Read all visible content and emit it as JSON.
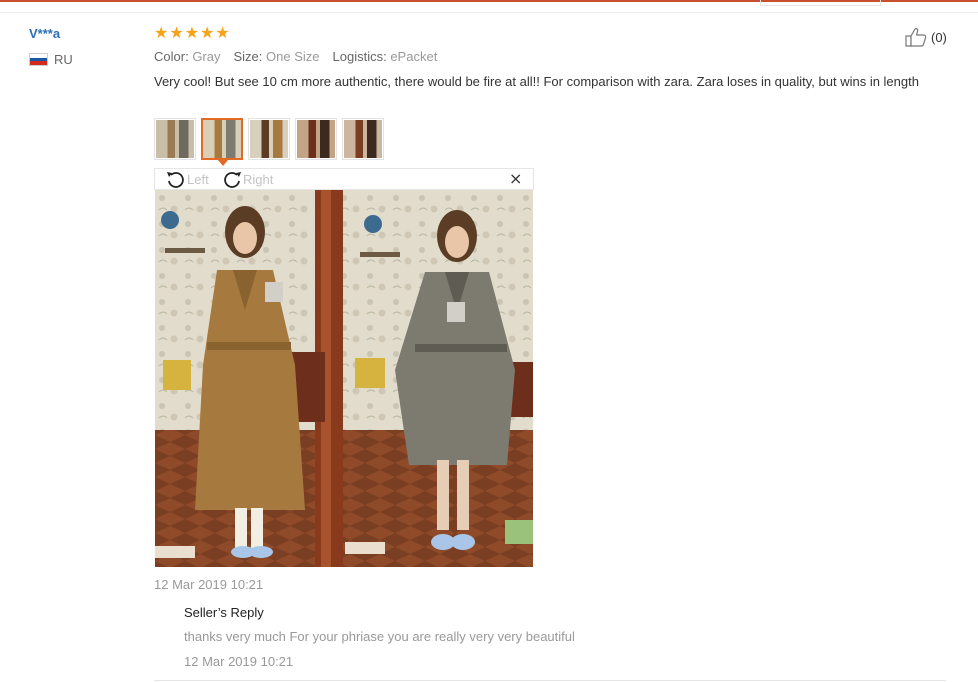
{
  "review": {
    "buyer": {
      "name": "V***a",
      "country": "RU",
      "flag_colors": [
        "#ffffff",
        "#1c57a5",
        "#d52b1e"
      ]
    },
    "rating": 5,
    "star_glyph": "★",
    "attributes": {
      "color_label": "Color:",
      "color_value": "Gray",
      "size_label": "Size:",
      "size_value": "One Size",
      "logistics_label": "Logistics:",
      "logistics_value": "ePacket"
    },
    "helpful": {
      "icon": "thumbs-up-icon",
      "count_text": "(0)"
    },
    "text": "Very cool! But see 10 cm more authentic, there would be fire at all!! For comparison with zara. Zara loses in quality, but wins in length",
    "thumbnails": [
      {
        "name": "photo-1",
        "active": false
      },
      {
        "name": "photo-2",
        "active": true
      },
      {
        "name": "photo-3",
        "active": false
      },
      {
        "name": "photo-4",
        "active": false
      },
      {
        "name": "photo-5",
        "active": false
      }
    ],
    "viewer": {
      "rotate_left_label": "Left",
      "rotate_right_label": "Right",
      "close_glyph": "×"
    },
    "date": "12 Mar 2019 10:21",
    "seller_reply": {
      "title": "Seller’s Reply",
      "text": "thanks very much For your phriase you are really very very beautiful",
      "date": "12 Mar 2019 10:21"
    }
  },
  "colors": {
    "accent": "#e26a25",
    "star": "#f7a21b",
    "link": "#2a6fb3",
    "muted": "#999999"
  }
}
